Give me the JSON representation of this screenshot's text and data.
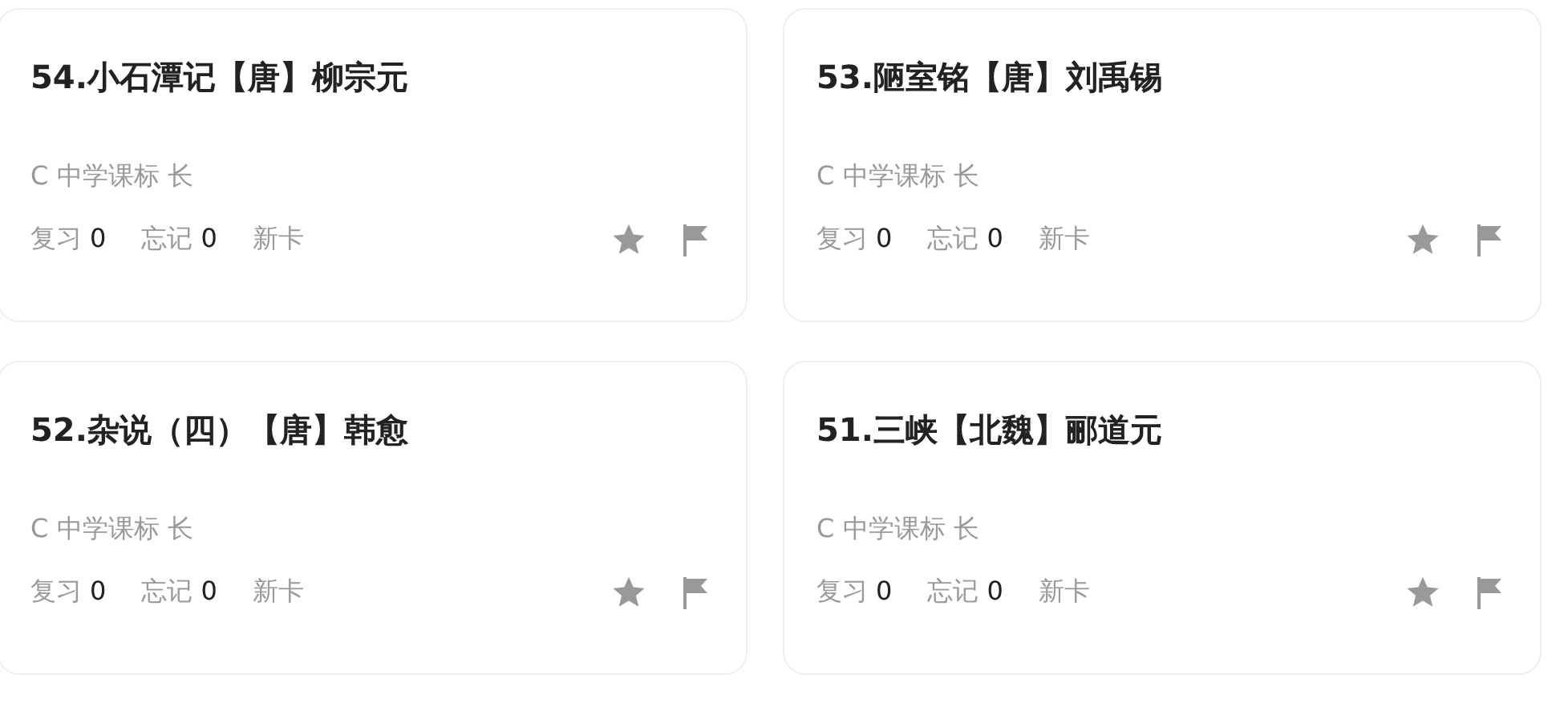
{
  "cards": [
    {
      "title": "54.小石潭记【唐】柳宗元",
      "meta": "C 中学课标 长",
      "stats": [
        {
          "label": "复习",
          "value": "0"
        },
        {
          "label": "忘记",
          "value": "0"
        },
        {
          "label": "新卡"
        }
      ]
    },
    {
      "title": "53.陋室铭【唐】刘禹锡",
      "meta": "C 中学课标 长",
      "stats": [
        {
          "label": "复习",
          "value": "0"
        },
        {
          "label": "忘记",
          "value": "0"
        },
        {
          "label": "新卡"
        }
      ]
    },
    {
      "title": "52.杂说（四）【唐】韩愈",
      "meta": "C 中学课标 长",
      "stats": [
        {
          "label": "复习",
          "value": "0"
        },
        {
          "label": "忘记",
          "value": "0"
        },
        {
          "label": "新卡"
        }
      ]
    },
    {
      "title": "51.三峡【北魏】郦道元",
      "meta": "C 中学课标 长",
      "stats": [
        {
          "label": "复习",
          "value": "0"
        },
        {
          "label": "忘记",
          "value": "0"
        },
        {
          "label": "新卡"
        }
      ]
    }
  ]
}
